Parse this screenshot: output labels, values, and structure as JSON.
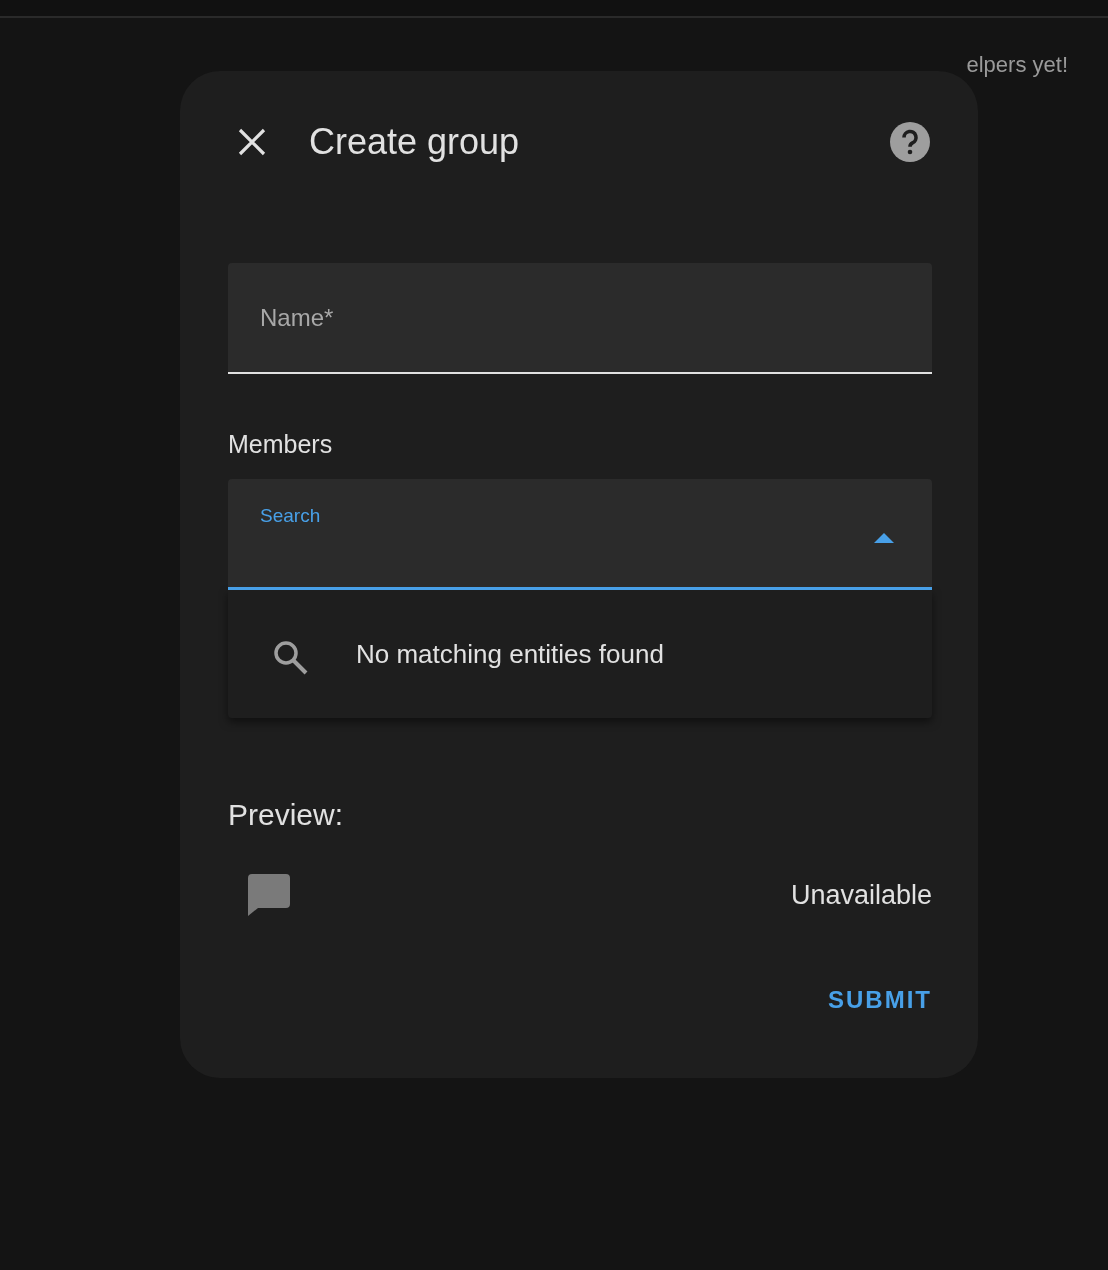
{
  "background_text": "elpers yet!",
  "dialog": {
    "title": "Create group",
    "name_field": {
      "label": "Name*"
    },
    "members_label": "Members",
    "search": {
      "label": "Search",
      "expanded": true
    },
    "dropdown_message": "No matching entities found",
    "preview_label": "Preview:",
    "preview": {
      "state": "Unavailable"
    },
    "submit": "SUBMIT"
  }
}
